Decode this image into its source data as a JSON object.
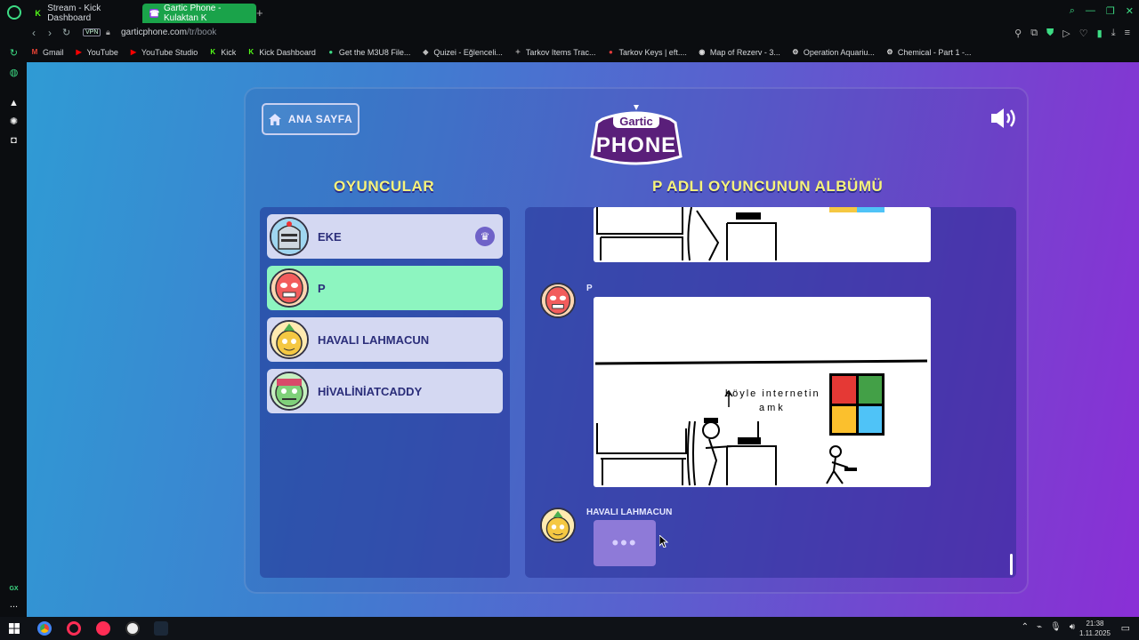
{
  "browser": {
    "tabs": [
      {
        "label": "Stream - Kick Dashboard",
        "favicon": "K"
      },
      {
        "label": "Gartic Phone - Kulaktan K",
        "favicon": "☎"
      }
    ],
    "new_tab": "+",
    "vpn": "VPN",
    "url_host": "garticphone.com",
    "url_path": "/tr/book",
    "bookmarks": [
      {
        "label": "Gmail",
        "icon": "M",
        "color": "#ea4335"
      },
      {
        "label": "YouTube",
        "icon": "▶",
        "color": "#ff0000"
      },
      {
        "label": "YouTube Studio",
        "icon": "▶",
        "color": "#ff0000"
      },
      {
        "label": "Kick",
        "icon": "K",
        "color": "#53fc18"
      },
      {
        "label": "Kick Dashboard",
        "icon": "K",
        "color": "#53fc18"
      },
      {
        "label": "Get the M3U8 File...",
        "icon": "●",
        "color": "#3ddc84"
      },
      {
        "label": "Quizei - Eğlenceli...",
        "icon": "◆",
        "color": "#bbbbbb"
      },
      {
        "label": "Tarkov Items Trac...",
        "icon": "✦",
        "color": "#888888"
      },
      {
        "label": "Tarkov Keys | eft....",
        "icon": "●",
        "color": "#e33b3b"
      },
      {
        "label": "Map of Rezerv - 3...",
        "icon": "◉",
        "color": "#dddddd"
      },
      {
        "label": "Operation Aquariu...",
        "icon": "⚙",
        "color": "#dddddd"
      },
      {
        "label": "Chemical - Part 1 -...",
        "icon": "⚙",
        "color": "#dddddd"
      }
    ]
  },
  "sidebar_gx": "GX",
  "sidebar_more": "...",
  "game": {
    "home_label": "ANA SAYFA",
    "logo_top": "Gartic",
    "logo_bottom": "PHONE",
    "players_title": "OYUNCULAR",
    "album_title": "P ADLI OYUNCUNUN ALBÜMÜ",
    "players": [
      {
        "name": "EKE",
        "host": true,
        "active": false
      },
      {
        "name": "P",
        "host": false,
        "active": true
      },
      {
        "name": "HAVALI LAHMACUN",
        "host": false,
        "active": false
      },
      {
        "name": "HİVALİNİATCADDY",
        "host": false,
        "active": false
      }
    ],
    "album": {
      "message1_author": "P",
      "drawing_text_1": "böyle internetin",
      "drawing_text_2": "amk",
      "message2_author": "HAVALI LAHMACUN",
      "typing_indicator": "•••"
    },
    "colors": {
      "heading": "#f6f37a",
      "active_player": "#8df5c0",
      "player_card": "#d4d8f2",
      "player_text": "#2b2e7a"
    }
  },
  "taskbar": {
    "time": "21:38",
    "date": "1.11.2025"
  }
}
